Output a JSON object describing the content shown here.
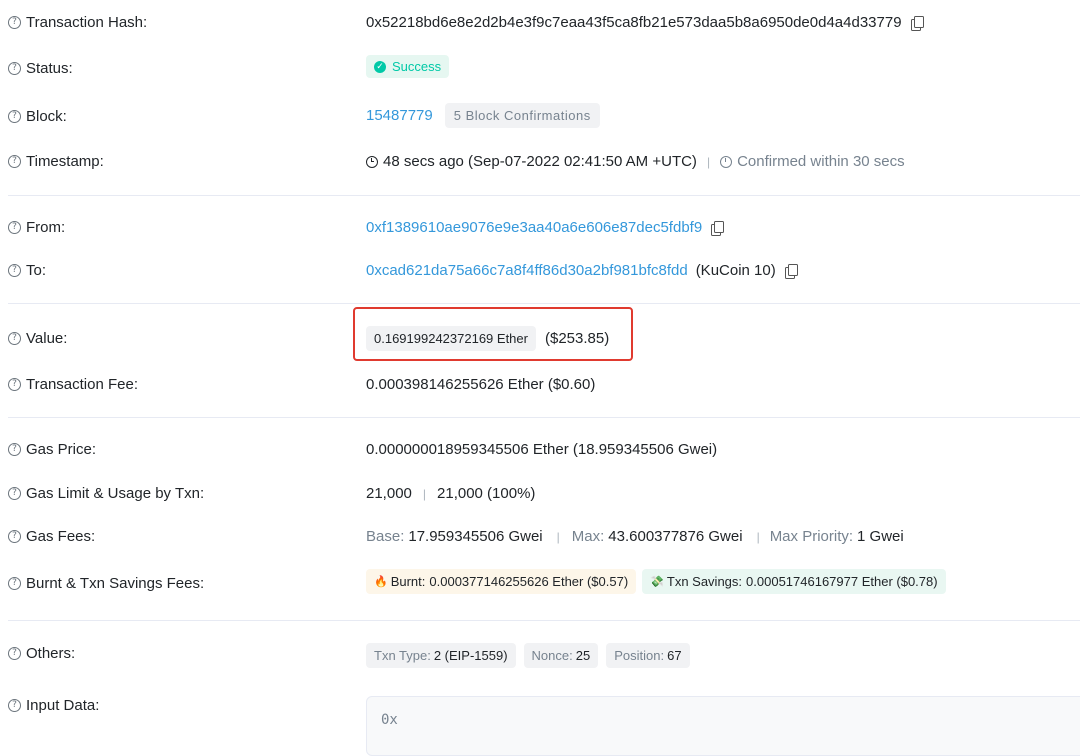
{
  "rows": {
    "tx_hash": {
      "label": "Transaction Hash:",
      "value": "0x52218bd6e8e2d2b4e3f9c7eaa43f5ca8fb21e573daa5b8a6950de0d4a4d33779"
    },
    "status": {
      "label": "Status:",
      "value": "Success"
    },
    "block": {
      "label": "Block:",
      "number": "15487779",
      "confirmations": "5 Block Confirmations"
    },
    "timestamp": {
      "label": "Timestamp:",
      "value": "48 secs ago (Sep-07-2022 02:41:50 AM +UTC)",
      "separator": "|",
      "confirmed": "Confirmed within 30 secs"
    },
    "from": {
      "label": "From:",
      "value": "0xf1389610ae9076e9e3aa40a6e606e87dec5fdbf9"
    },
    "to": {
      "label": "To:",
      "value": "0xcad621da75a66c7a8f4ff86d30a2bf981bfc8fdd",
      "name": "(KuCoin 10)"
    },
    "value": {
      "label": "Value:",
      "amount": "0.169199242372169 Ether",
      "usd": "($253.85)"
    },
    "tx_fee": {
      "label": "Transaction Fee:",
      "value": "0.000398146255626 Ether ($0.60)"
    },
    "gas_price": {
      "label": "Gas Price:",
      "value": "0.000000018959345506 Ether (18.959345506 Gwei)"
    },
    "gas_limit": {
      "label": "Gas Limit & Usage by Txn:",
      "limit": "21,000",
      "separator": "|",
      "usage": "21,000 (100%)"
    },
    "gas_fees": {
      "label": "Gas Fees:",
      "base_label": "Base:",
      "base_value": "17.959345506 Gwei",
      "separator": "|",
      "max_label": "Max:",
      "max_value": "43.600377876 Gwei",
      "max_priority_label": "Max Priority:",
      "max_priority_value": "1 Gwei"
    },
    "burnt": {
      "label": "Burnt & Txn Savings Fees:",
      "burnt_icon": "🔥",
      "burnt_label": "Burnt:",
      "burnt_value": "0.000377146255626 Ether ($0.57)",
      "savings_icon": "💸",
      "savings_label": "Txn Savings:",
      "savings_value": "0.00051746167977 Ether ($0.78)"
    },
    "others": {
      "label": "Others:",
      "txn_type_label": "Txn Type:",
      "txn_type_value": "2 (EIP-1559)",
      "nonce_label": "Nonce:",
      "nonce_value": "25",
      "position_label": "Position:",
      "position_value": "67"
    },
    "input_data": {
      "label": "Input Data:",
      "value": "0x"
    }
  },
  "icons": {
    "help": "?",
    "check": "✓"
  },
  "colors": {
    "link": "#3498db",
    "success": "#00c9a7",
    "highlight": "#e03a2f",
    "muted": "#77838f"
  }
}
